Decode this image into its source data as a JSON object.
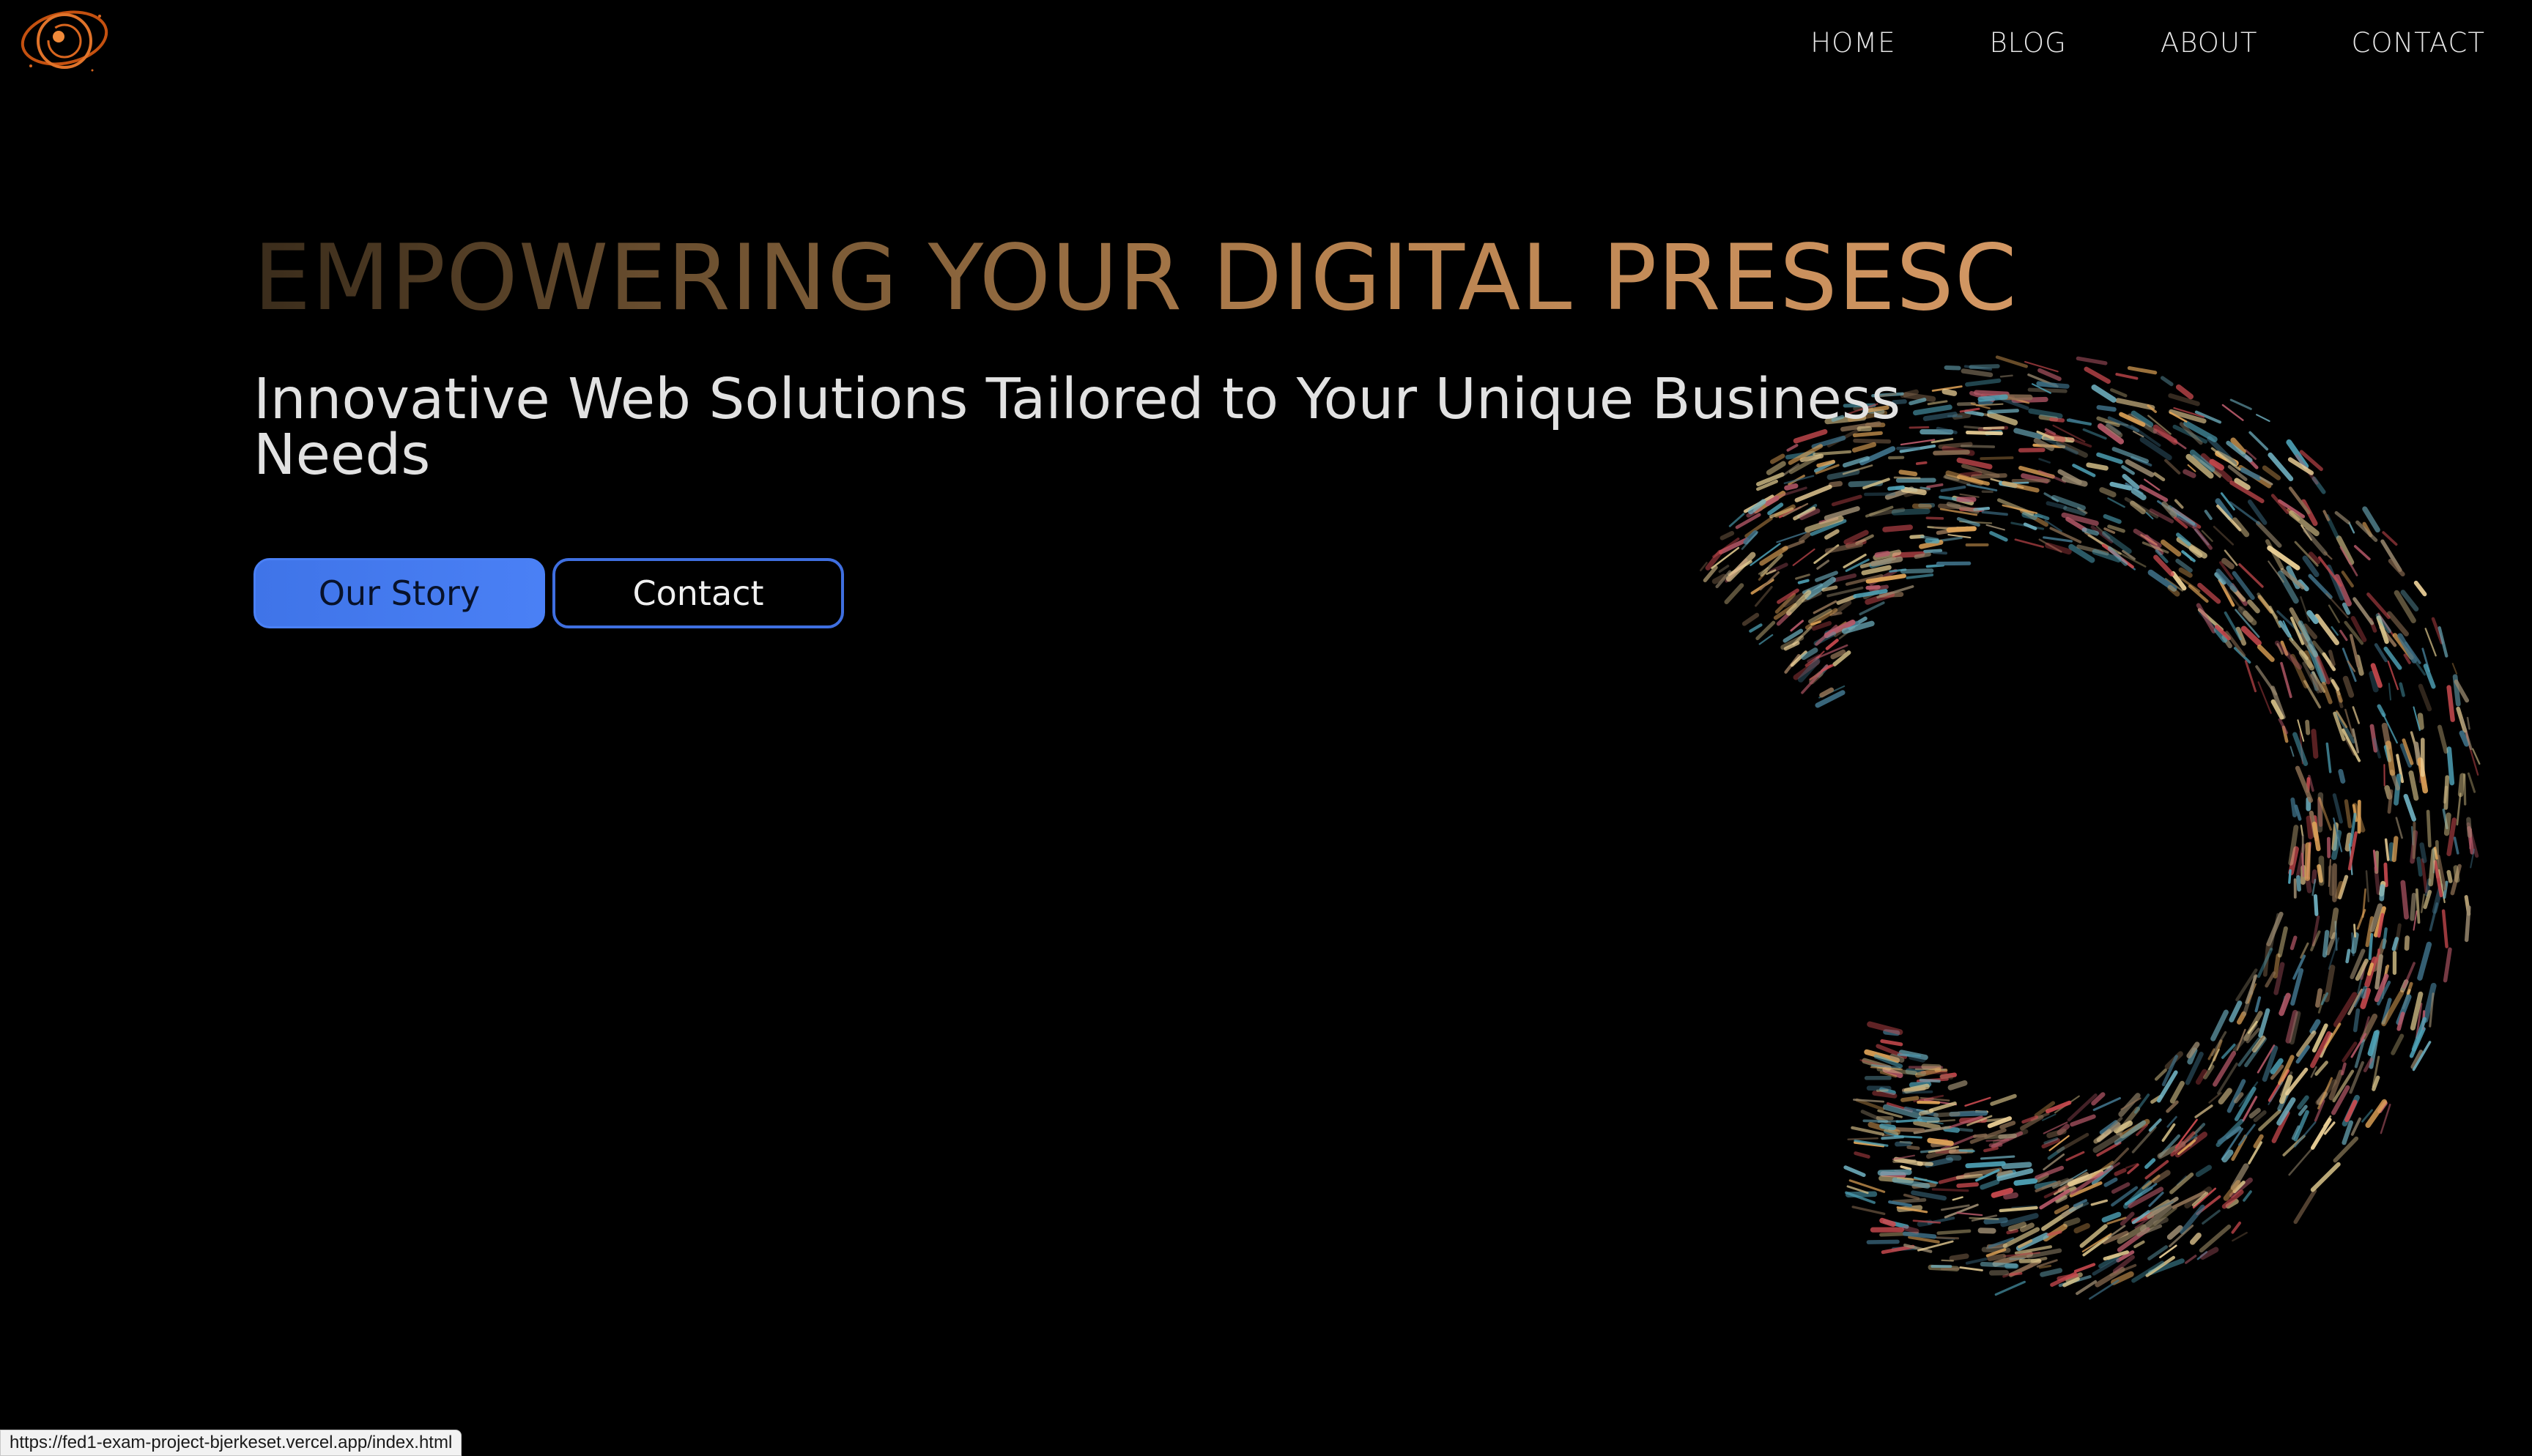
{
  "header": {
    "logo_icon": "orbit-logo-icon",
    "nav": [
      {
        "label": "HOME"
      },
      {
        "label": "BLOG"
      },
      {
        "label": "ABOUT"
      },
      {
        "label": "CONTACT"
      }
    ]
  },
  "hero": {
    "title": "EMPOWERING YOUR DIGITAL PRESESCE",
    "subtitle": "Innovative Web Solutions Tailored to Your Unique Business Needs",
    "primary_button": "Our Story",
    "secondary_button": "Contact"
  },
  "status_bar": {
    "url": "https://fed1-exam-project-bjerkeset.vercel.app/index.html"
  },
  "colors": {
    "background": "#000000",
    "accent_blue": "#4a80f5",
    "title_gold": "#d39763",
    "logo_orange": "#d9661f"
  }
}
